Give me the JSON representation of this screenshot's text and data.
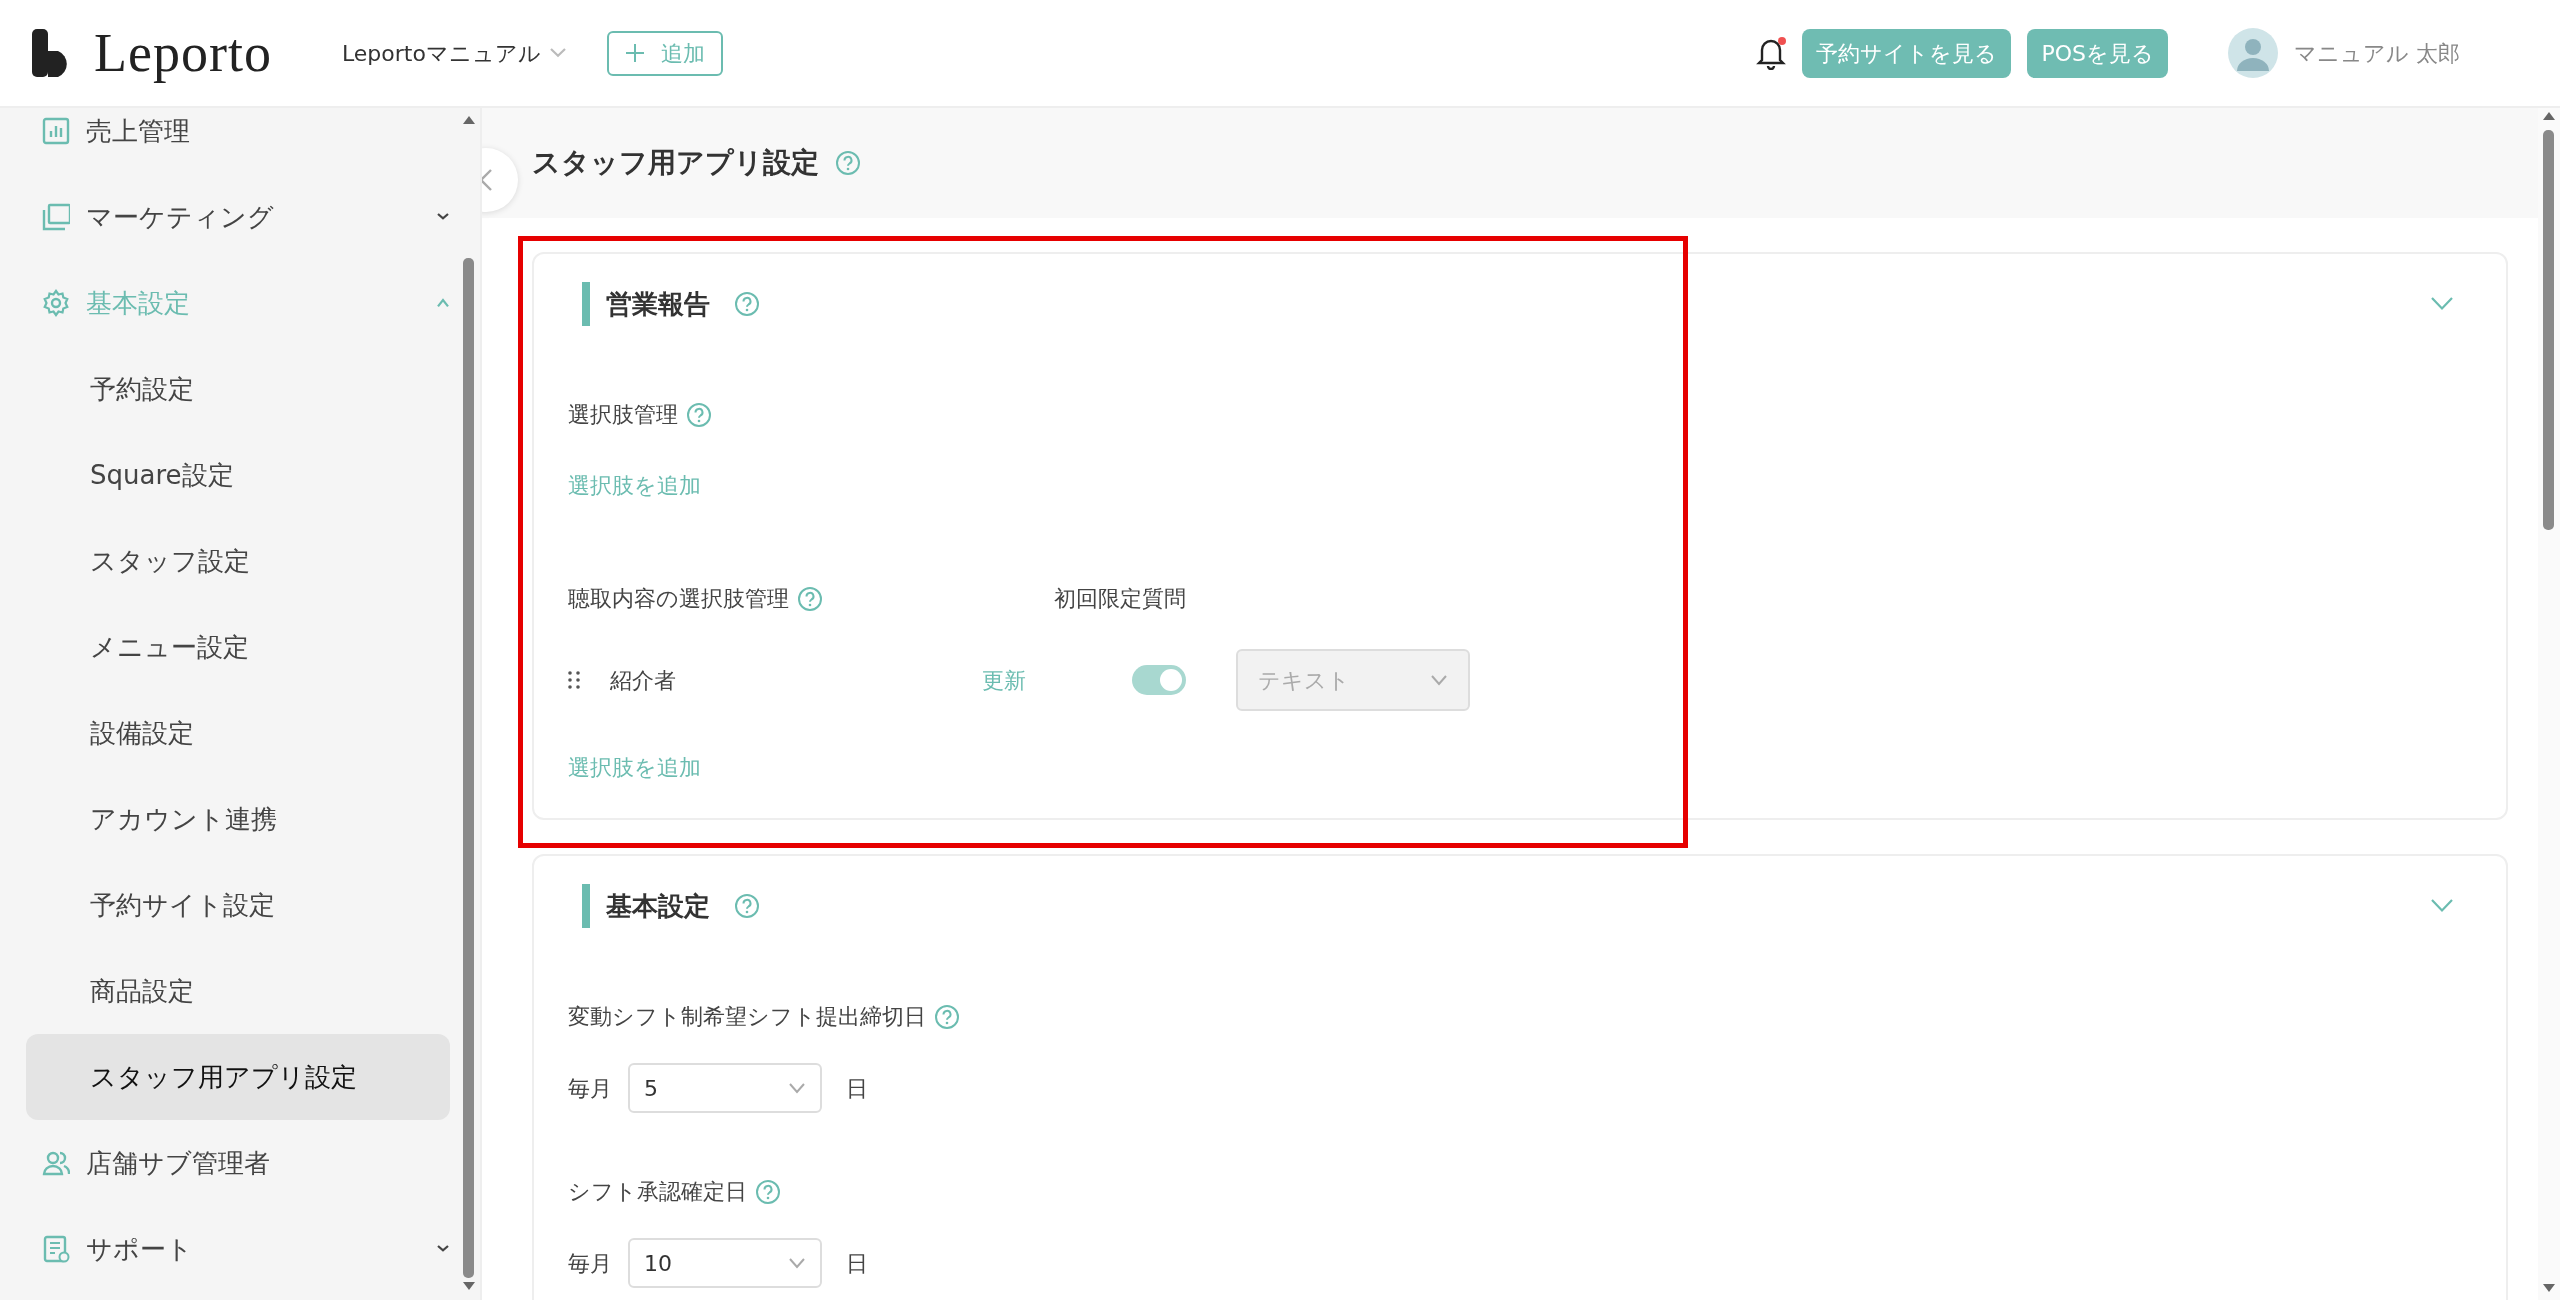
{
  "header": {
    "logo": "Leporto",
    "store_selector": "Leportoマニュアル",
    "add_button": "追加",
    "notification": {
      "unread": true
    },
    "buttons": [
      "予約サイトを見る",
      "POSを見る"
    ],
    "user_name": "マニュアル 太郎"
  },
  "sidebar": {
    "items": [
      {
        "label": "売上管理",
        "selected": false
      },
      {
        "label": "マーケティング",
        "selected": false,
        "expanded": false
      },
      {
        "label": "基本設定",
        "selected": true,
        "expanded": true,
        "children": [
          {
            "label": "予約設定",
            "selected": false
          },
          {
            "label": "Square設定",
            "selected": false
          },
          {
            "label": "スタッフ設定",
            "selected": false
          },
          {
            "label": "メニュー設定",
            "selected": false
          },
          {
            "label": "設備設定",
            "selected": false
          },
          {
            "label": "アカウント連携",
            "selected": false
          },
          {
            "label": "予約サイト設定",
            "selected": false
          },
          {
            "label": "商品設定",
            "selected": false
          },
          {
            "label": "スタッフ用アプリ設定",
            "selected": true
          }
        ]
      },
      {
        "label": "店舗サブ管理者",
        "selected": false
      },
      {
        "label": "サポート",
        "selected": false,
        "expanded": false
      }
    ]
  },
  "page_title": "スタッフ用アプリ設定",
  "sections": [
    {
      "title": "営業報告",
      "expanded": true,
      "highlighted": true,
      "fields": [
        {
          "kind": "heading",
          "label": "選択肢管理"
        },
        {
          "kind": "link",
          "label": "選択肢を追加"
        },
        {
          "kind": "choice_header",
          "label": "聴取内容の選択肢管理",
          "column": "初回限定質問"
        },
        {
          "kind": "choice_row",
          "name": "紹介者",
          "action": "更新",
          "on": true,
          "select": {
            "value": "テキスト",
            "disabled": true
          }
        },
        {
          "kind": "link",
          "label": "選択肢を追加"
        }
      ]
    },
    {
      "title": "基本設定",
      "expanded": true,
      "highlighted": false,
      "fields": [
        {
          "kind": "heading",
          "label": "変動シフト制希望シフト提出締切日"
        },
        {
          "kind": "day_select",
          "prefix": "毎月",
          "value": "5",
          "suffix": "日"
        },
        {
          "kind": "heading",
          "label": "シフト承認確定日"
        },
        {
          "kind": "day_select",
          "prefix": "毎月",
          "value": "10",
          "suffix": "日"
        }
      ]
    }
  ]
}
